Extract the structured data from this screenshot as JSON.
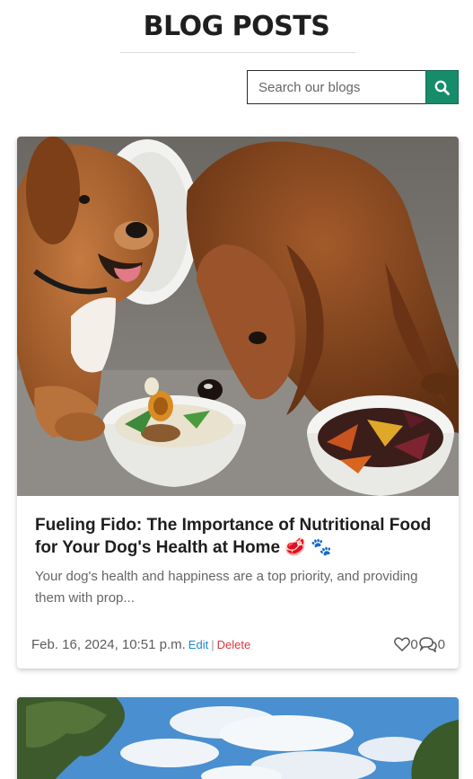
{
  "header": {
    "title": "BLOG POSTS"
  },
  "search": {
    "placeholder": "Search our blogs",
    "button_icon": "search-icon",
    "accent": "#178c6a"
  },
  "posts": [
    {
      "title": "Fueling Fido: The Importance of Nutritional Food for Your Dog's Health at Home 🥩 🐾",
      "excerpt": "Your dog's health and happiness are a top priority, and providing them with prop...",
      "date": "Feb. 16, 2024, 10:51 p.m.",
      "edit_label": "Edit",
      "separator": "|",
      "delete_label": "Delete",
      "likes": "0",
      "comments": "0",
      "image": "illustration of two dogs eating food from white bowls"
    },
    {
      "image": "outdoor scene with trees and blue sky with clouds"
    }
  ],
  "colors": {
    "edit": "#1d87d0",
    "delete": "#d9363e"
  }
}
